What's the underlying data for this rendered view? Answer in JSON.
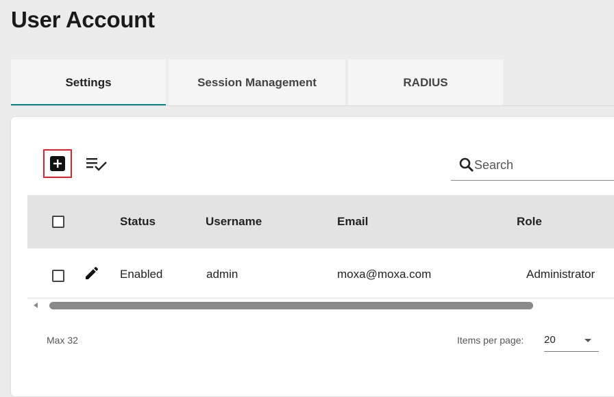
{
  "page": {
    "title": "User Account"
  },
  "tabs": [
    {
      "label": "Settings",
      "active": true
    },
    {
      "label": "Session Management",
      "active": false
    },
    {
      "label": "RADIUS",
      "active": false
    }
  ],
  "toolbar": {
    "add_icon": "add-box-icon",
    "checklist_icon": "checklist-icon"
  },
  "search": {
    "placeholder": "Search",
    "value": ""
  },
  "table": {
    "columns": [
      "Status",
      "Username",
      "Email",
      "Role"
    ],
    "rows": [
      {
        "status": "Enabled",
        "username": "admin",
        "email": "moxa@moxa.com",
        "role": "Administrator"
      }
    ]
  },
  "footer": {
    "max_label": "Max 32",
    "items_per_page_label": "Items per page:",
    "items_per_page_value": "20"
  },
  "colors": {
    "accent": "#008787",
    "highlight_border": "#e0202a"
  }
}
